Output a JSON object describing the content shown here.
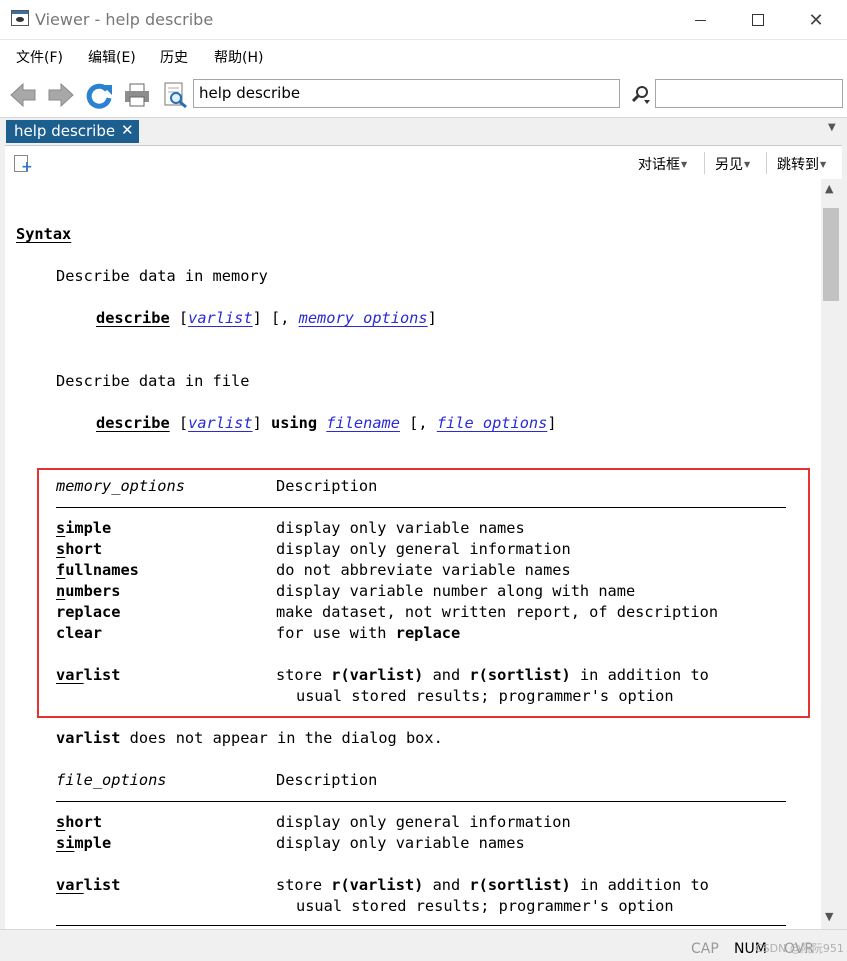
{
  "window": {
    "title": "Viewer - help describe"
  },
  "menu": [
    "文件(F)",
    "编辑(E)",
    "历史",
    "帮助(H)"
  ],
  "toolbar": {
    "command_value": "help describe",
    "search_value": ""
  },
  "tab": {
    "label": "help describe",
    "close": "✕"
  },
  "subbar": {
    "dialog": "对话框",
    "seealso": "另见",
    "jump": "跳转到"
  },
  "help": {
    "heading": "Syntax",
    "memory_intro": "Describe data in memory",
    "memory_syntax": {
      "cmd": "describe",
      "arg1": "varlist",
      "arg2": "memory_options"
    },
    "file_intro": "Describe data in file",
    "file_syntax": {
      "cmd": "describe",
      "arg1": "varlist",
      "using": "using",
      "arg2": "filename",
      "arg3": "file_options"
    },
    "memory_table": {
      "col1": "memory_options",
      "col2": "Description",
      "rows": [
        {
          "opt": "simple",
          "ul": "s",
          "desc": "display only variable names"
        },
        {
          "opt": "short",
          "ul": "",
          "desc": "display only general information"
        },
        {
          "opt": "fullnames",
          "ul": "",
          "desc": "do not abbreviate variable names"
        },
        {
          "opt": "numbers",
          "ul": "",
          "desc": "display variable number along with name"
        },
        {
          "opt": "replace",
          "ul": "",
          "desc": "make dataset, not written report, of description"
        },
        {
          "opt": "clear",
          "ul": "",
          "desc_pre": "for use with ",
          "desc_bold": "replace"
        }
      ],
      "varlist_row": {
        "opt": "varlist",
        "pre": "store ",
        "r1": "r(varlist)",
        "mid": " and ",
        "r2": "r(sortlist)",
        "post": " in addition to",
        "cont": "usual stored results; programmer's option"
      }
    },
    "note": {
      "bold": "varlist",
      "rest": " does not appear in the dialog box."
    },
    "file_table": {
      "col1": "file_options",
      "col2": "Description",
      "rows": [
        {
          "opt": "short",
          "desc": "display only general information"
        },
        {
          "opt": "simple",
          "desc": "display only variable names"
        }
      ],
      "varlist_row": {
        "opt": "varlist",
        "pre": "store ",
        "r1": "r(varlist)",
        "mid": " and ",
        "r2": "r(sortlist)",
        "post": " in addition to",
        "cont": "usual stored results; programmer's option"
      }
    }
  },
  "status": {
    "cap": "CAP",
    "num": "NUM",
    "ovr": "OVR"
  },
  "watermark": "CSDN @阮阮951",
  "colors": {
    "tab": "#1c5f8e",
    "link": "#2a2ad8",
    "highlight_box": "#e53333"
  }
}
